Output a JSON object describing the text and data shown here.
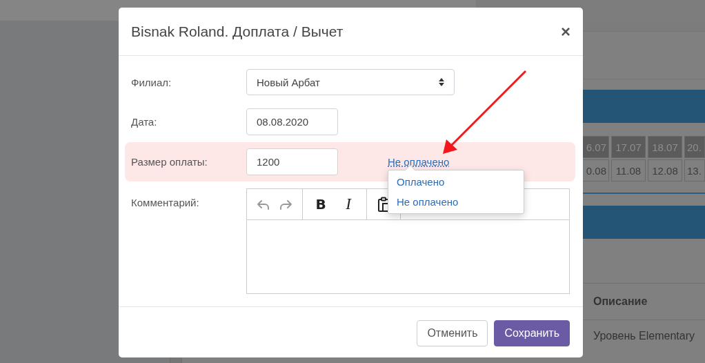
{
  "background": {
    "date_rows": [
      {
        "kind": "header",
        "cells": [
          "6.07",
          "17.07",
          "18.07",
          "20."
        ]
      },
      {
        "kind": "plain",
        "cells": [
          "0.08",
          "11.08",
          "12.08",
          "13."
        ]
      }
    ],
    "table": {
      "columns": [
        "Описание"
      ],
      "rows": [
        [
          "Уровень Elementary"
        ]
      ]
    }
  },
  "modal": {
    "title": "Bisnak Roland. Доплата / Вычет",
    "close": "×",
    "fields": [
      {
        "kind": "select",
        "label": "Филиал:",
        "value": "Новый Арбат"
      },
      {
        "kind": "input",
        "label": "Дата:",
        "value": "08.08.2020"
      },
      {
        "kind": "payment",
        "label": "Размер оплаты:",
        "value": "1200",
        "highlighted": true,
        "status": "Не оплачено",
        "menu": [
          {
            "label": "Оплачено",
            "selected": false
          },
          {
            "label": "Не оплачено",
            "selected": false
          }
        ]
      },
      {
        "kind": "editor",
        "label": "Комментарий:",
        "history_disabled": true,
        "format_buttons": [
          "B",
          "I"
        ]
      }
    ],
    "buttons": [
      {
        "kind": "secondary",
        "label": "Отменить"
      },
      {
        "kind": "primary",
        "label": "Сохранить"
      }
    ]
  }
}
